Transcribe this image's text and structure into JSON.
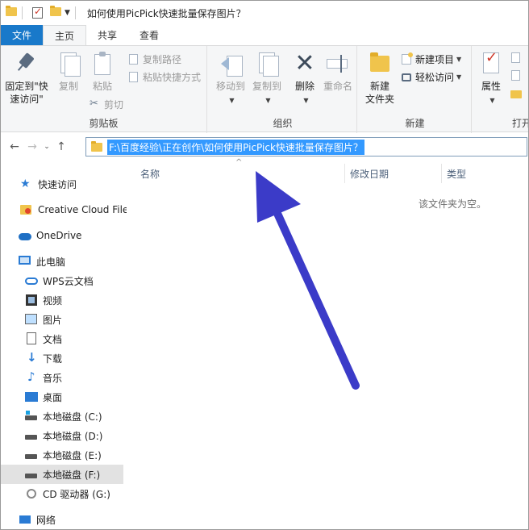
{
  "window": {
    "title": "如何使用PicPick快速批量保存图片？"
  },
  "ribbon_tabs": [
    "文件",
    "主页",
    "共享",
    "查看"
  ],
  "ribbon": {
    "clipboard": {
      "pin_label_1": "固定到\"快",
      "pin_label_2": "速访问\"",
      "copy": "复制",
      "paste": "粘贴",
      "copy_path": "复制路径",
      "paste_shortcut": "粘贴快捷方式",
      "cut": "剪切",
      "group_label": "剪贴板"
    },
    "organize": {
      "move_to": "移动到",
      "copy_to": "复制到",
      "delete": "删除",
      "rename": "重命名",
      "group_label": "组织"
    },
    "new": {
      "new_folder_1": "新建",
      "new_folder_2": "文件夹",
      "new_item": "新建项目",
      "easy_access": "轻松访问",
      "group_label": "新建"
    },
    "open": {
      "properties": "属性",
      "group_label": "打开"
    }
  },
  "address": {
    "path": "F:\\百度经验\\正在创作\\如何使用PicPick快速批量保存图片？"
  },
  "navpane": {
    "items": [
      {
        "label": "快速访问",
        "icon": "star-icon"
      },
      {
        "label": "Creative Cloud File",
        "icon": "creative-cloud-icon"
      },
      {
        "label": "OneDrive",
        "icon": "cloud-icon"
      },
      {
        "label": "此电脑",
        "icon": "computer-icon"
      },
      {
        "label": "WPS云文档",
        "icon": "wps-cloud-icon"
      },
      {
        "label": "视频",
        "icon": "video-icon"
      },
      {
        "label": "图片",
        "icon": "picture-icon"
      },
      {
        "label": "文档",
        "icon": "document-icon"
      },
      {
        "label": "下载",
        "icon": "download-icon"
      },
      {
        "label": "音乐",
        "icon": "music-icon"
      },
      {
        "label": "桌面",
        "icon": "desktop-icon"
      },
      {
        "label": "本地磁盘 (C:)",
        "icon": "drive-icon"
      },
      {
        "label": "本地磁盘 (D:)",
        "icon": "drive-icon"
      },
      {
        "label": "本地磁盘 (E:)",
        "icon": "drive-icon"
      },
      {
        "label": "本地磁盘 (F:)",
        "icon": "drive-icon"
      },
      {
        "label": "CD 驱动器 (G:)",
        "icon": "cd-icon"
      },
      {
        "label": "网络",
        "icon": "network-icon"
      }
    ],
    "selected": "本地磁盘 (F:)"
  },
  "content": {
    "columns": [
      "名称",
      "修改日期",
      "类型"
    ],
    "empty_message": "该文件夹为空。"
  },
  "colors": {
    "file_tab": "#1979ca",
    "address_highlight": "#3399ff",
    "annotation_arrow": "#3b3bc8"
  }
}
